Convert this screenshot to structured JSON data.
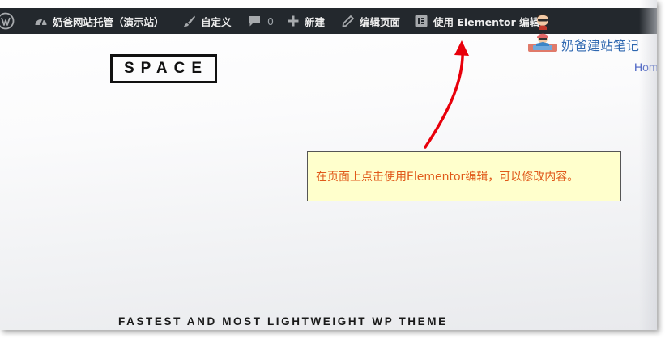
{
  "admin_bar": {
    "site_name": "奶爸网站托管（演示站）",
    "customize": "自定义",
    "comments_count": "0",
    "new": "新建",
    "edit_page": "编辑页面",
    "elementor_edit": "使用 Elementor 编辑"
  },
  "site": {
    "logo": "SPACE",
    "nav_home": "Home",
    "tagline": "FASTEST AND MOST LIGHTWEIGHT WP THEME"
  },
  "watermark": "奶爸建站笔记",
  "callout": "在页面上点击使用Elementor编辑，可以修改内容。",
  "colors": {
    "admin_bar_bg": "#23282d",
    "callout_bg": "#ffffcc",
    "callout_text": "#e05a1a",
    "arrow": "#e8000b",
    "link": "#4a63c4"
  }
}
